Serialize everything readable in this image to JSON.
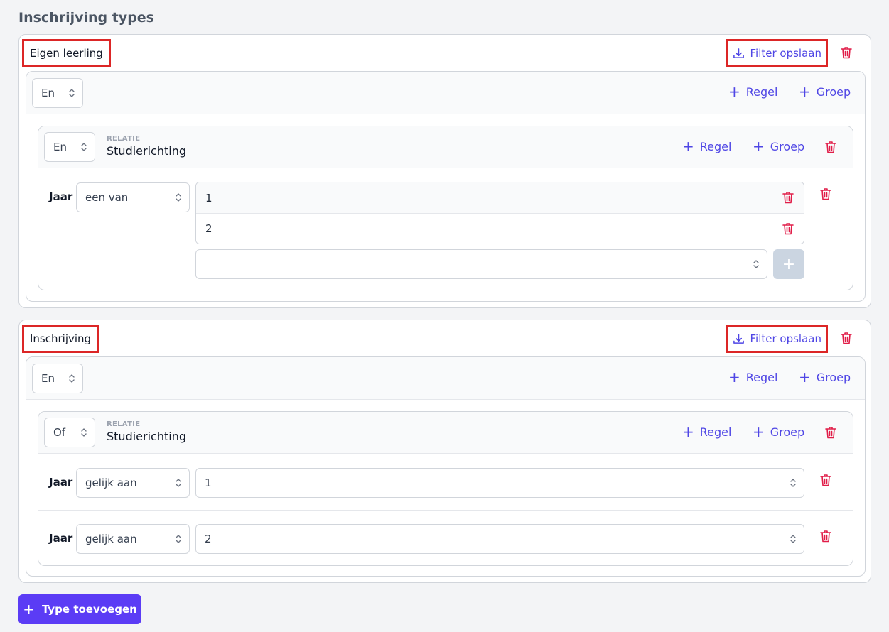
{
  "page": {
    "title": "Inschrijving types"
  },
  "actions": {
    "save_filter": "Filter opslaan",
    "add_rule": "Regel",
    "add_group": "Groep",
    "add_type": "Type toevoegen",
    "add_value_glyph": "+"
  },
  "relation_label": "RELATIE",
  "types": [
    {
      "name": "Eigen leerling",
      "root_operator": "En",
      "group": {
        "operator": "En",
        "relation": "Studierichting",
        "rule": {
          "field": "Jaar",
          "comparator": "een van",
          "values": [
            "1",
            "2"
          ],
          "new_value": ""
        }
      }
    },
    {
      "name": "Inschrijving",
      "root_operator": "En",
      "group": {
        "operator": "Of",
        "relation": "Studierichting",
        "rules": [
          {
            "field": "Jaar",
            "comparator": "gelijk aan",
            "value": "1"
          },
          {
            "field": "Jaar",
            "comparator": "gelijk aan",
            "value": "2"
          }
        ]
      }
    }
  ],
  "colors": {
    "accent": "#4f46e5",
    "primary_button": "#5b3cf5",
    "danger": "#e11d48",
    "highlight_box": "#dc2626"
  }
}
